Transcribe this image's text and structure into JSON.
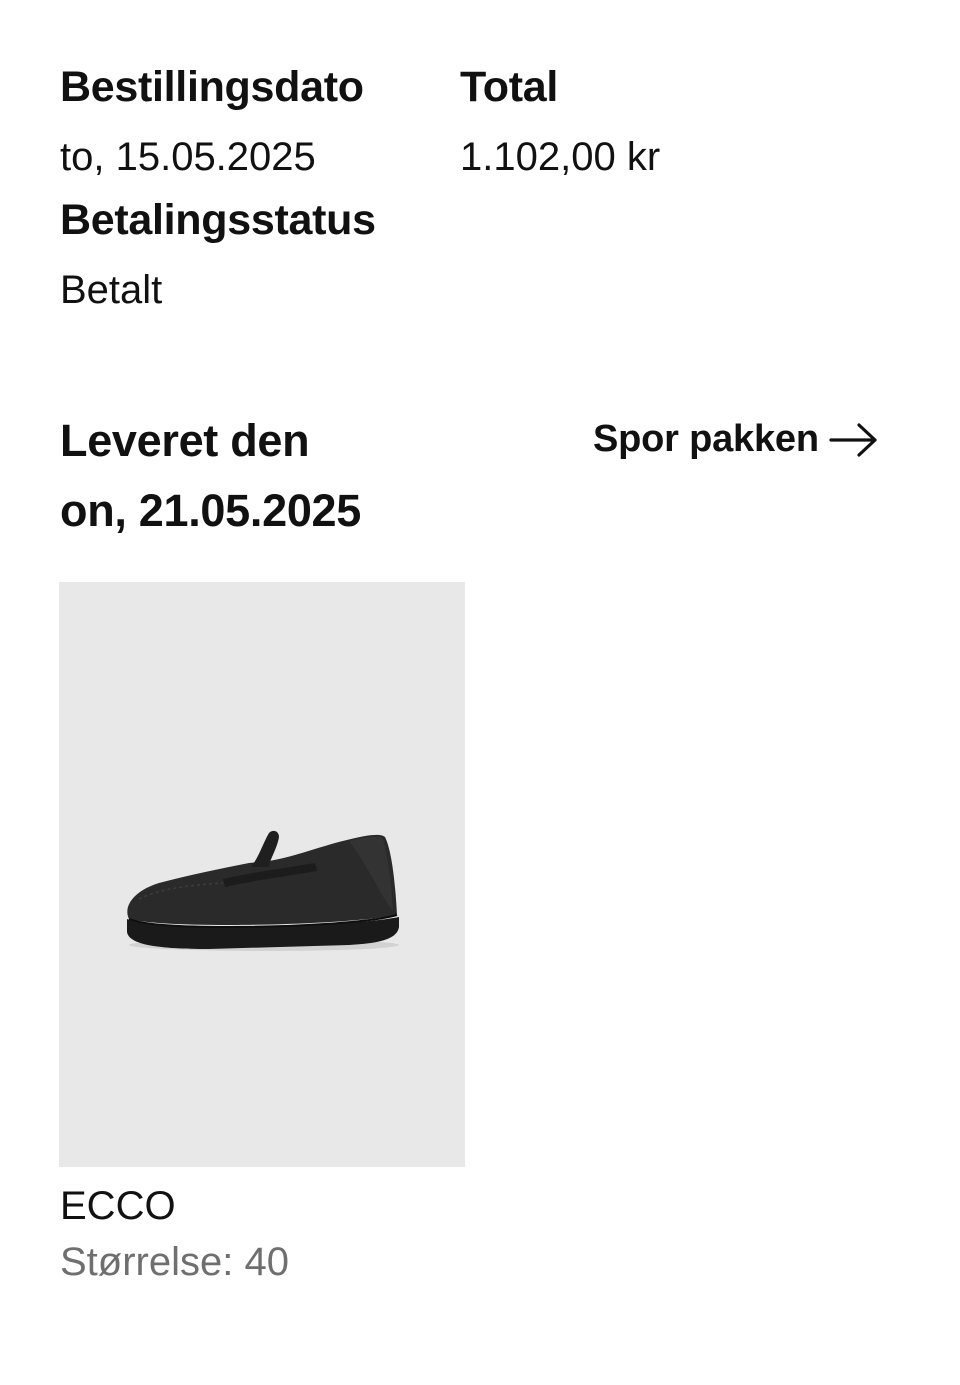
{
  "order": {
    "date_label": "Bestillingsdato",
    "date_value": "to, 15.05.2025",
    "total_label": "Total",
    "total_value": "1.102,00 kr",
    "payment_label": "Betalingsstatus",
    "payment_value": "Betalt"
  },
  "delivery": {
    "title_line1": "Leveret den",
    "title_line2": "on, 21.05.2025",
    "track_label": "Spor pakken",
    "track_icon": "arrow-right-icon"
  },
  "product": {
    "image_icon": "loafer-shoe-image",
    "brand": "ECCO",
    "size": "Størrelse: 40"
  },
  "colors": {
    "text": "#111111",
    "muted": "#6f6f6f",
    "image_bg": "#e8e8e8"
  }
}
